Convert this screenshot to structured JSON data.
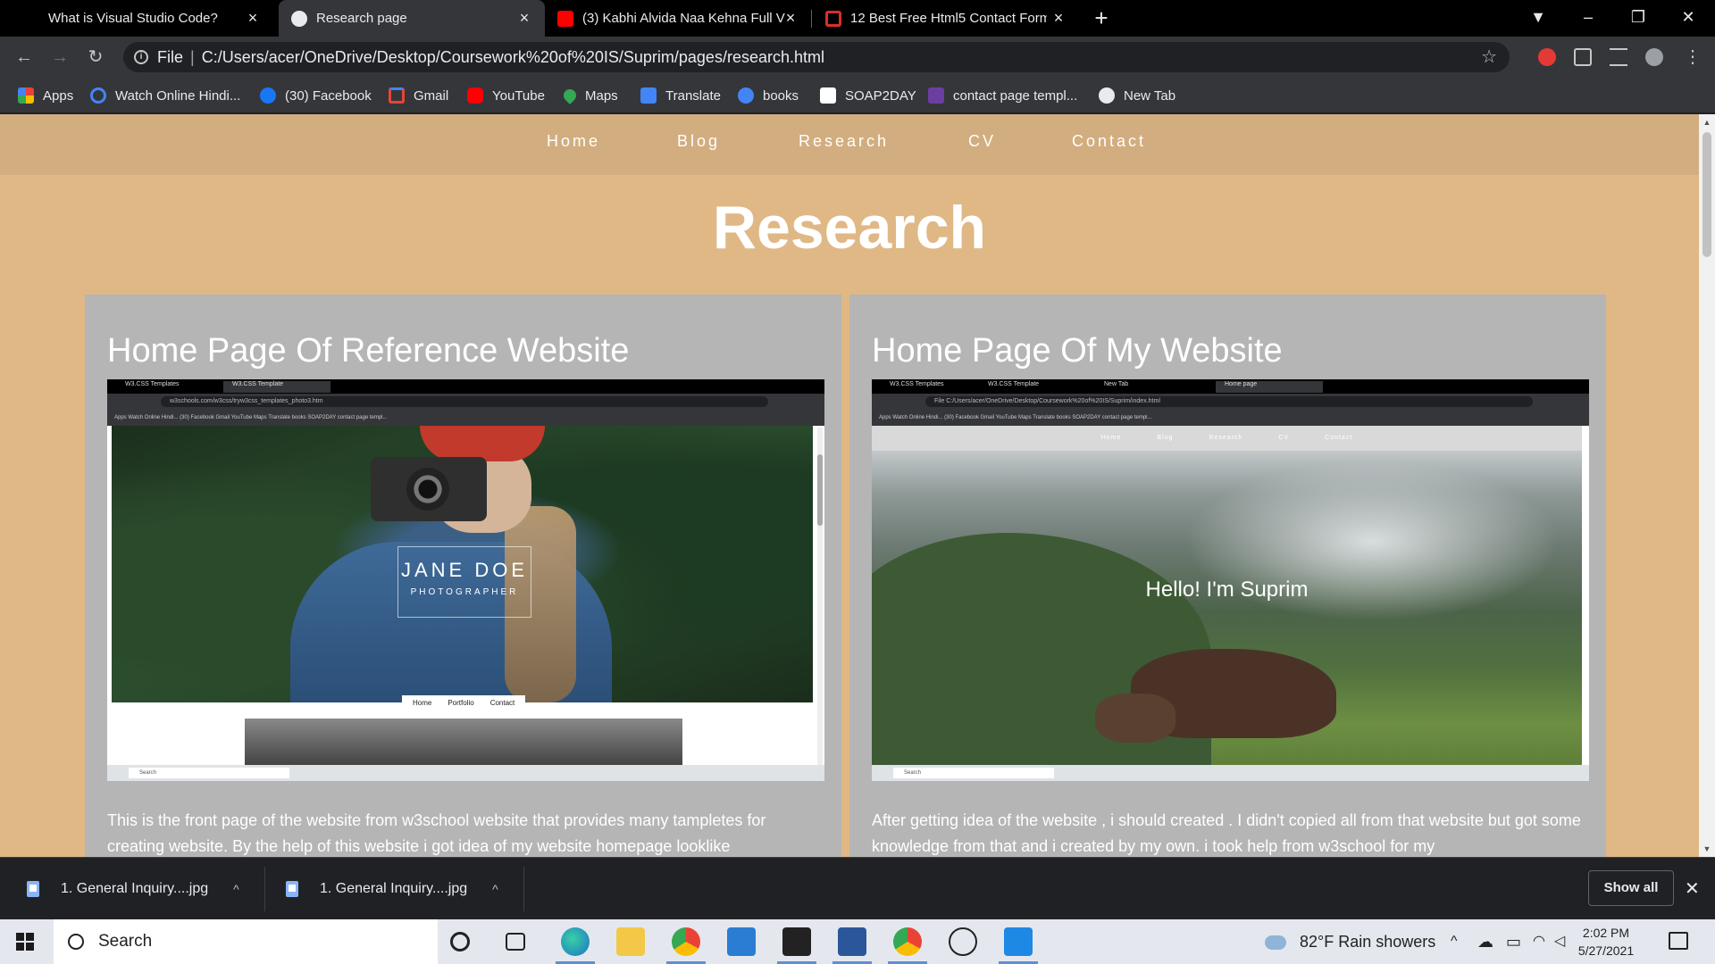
{
  "tabs": [
    {
      "title": "What is Visual Studio Code?",
      "active": false,
      "favicon_color": "#000000"
    },
    {
      "title": "Research page",
      "active": true,
      "favicon_color": "#e8eaed"
    },
    {
      "title": "(3) Kabhi Alvida Naa Kehna Full V",
      "active": false,
      "favicon_color": "#ff0000"
    },
    {
      "title": "12 Best Free Html5 Contact Form",
      "active": false,
      "favicon_color": "#d93025"
    }
  ],
  "tab_icons": {
    "close": "×",
    "new_tab": "+",
    "profile": "▼",
    "minimize": "–",
    "restore": "❐",
    "close_window": "✕"
  },
  "address": {
    "scheme": "File",
    "url": "C:/Users/acer/OneDrive/Desktop/Coursework%20of%20IS/Suprim/pages/research.html",
    "info_icon": "i",
    "star_icon": "☆"
  },
  "nav_icons": {
    "back": "←",
    "forward": "→",
    "reload": "↻",
    "menu": "⋮"
  },
  "bookmarks": [
    {
      "label": "Apps",
      "color": "#ea4335"
    },
    {
      "label": "Watch Online Hindi...",
      "color": "#4285f4"
    },
    {
      "label": "(30) Facebook",
      "color": "#1877f2"
    },
    {
      "label": "Gmail",
      "color": "#ea4335"
    },
    {
      "label": "YouTube",
      "color": "#ff0000"
    },
    {
      "label": "Maps",
      "color": "#34a853"
    },
    {
      "label": "Translate",
      "color": "#4285f4"
    },
    {
      "label": "books",
      "color": "#4285f4"
    },
    {
      "label": "SOAP2DAY",
      "color": "#ffffff"
    },
    {
      "label": "contact page templ...",
      "color": "#6b3fa0"
    },
    {
      "label": "New Tab",
      "color": "#e8eaed"
    }
  ],
  "site": {
    "nav": [
      "Home",
      "Blog",
      "Research",
      "CV",
      "Contact"
    ],
    "title": "Research",
    "cards": [
      {
        "heading": "Home Page Of Reference Website",
        "text": "This is the front page of the website from w3school website that provides many tampletes for creating website. By the help of this website i got idea of my website homepage looklike"
      },
      {
        "heading": "Home Page Of My Website",
        "text": "After getting idea of the website , i should created . I didn't copied all from that website but got some knowledge from that and i created by my own. i took help from w3school for my"
      }
    ],
    "left_shot": {
      "tabs": [
        "W3.CSS Templates",
        "W3.CSS Template"
      ],
      "url": "w3schools.com/w3css/tryw3css_templates_photo3.htm",
      "bookmarks": "Apps   Watch Online Hindi...   (30) Facebook   Gmail   YouTube   Maps   Translate   books   SOAP2DAY   contact page templ...",
      "brand_name": "JANE DOE",
      "brand_role": "PHOTOGRAPHER",
      "mini_nav": [
        "Home",
        "Portfolio",
        "Contact"
      ],
      "search": "Search"
    },
    "right_shot": {
      "tabs": [
        "W3.CSS Templates",
        "W3.CSS Template",
        "New Tab",
        "Home page"
      ],
      "url": "File   C:/Users/acer/OneDrive/Desktop/Coursework%20of%20IS/Suprim/index.html",
      "bookmarks": "Apps   Watch Online Hindi...   (30) Facebook   Gmail   YouTube   Maps   Translate   books   SOAP2DAY   contact page templ...",
      "nav": [
        "Home",
        "Blog",
        "Research",
        "CV",
        "Contact"
      ],
      "greeting": "Hello! I'm Suprim",
      "search": "Search"
    }
  },
  "downloads": {
    "items": [
      "1. General Inquiry....jpg",
      "1. General Inquiry....jpg"
    ],
    "caret": "^",
    "show_all": "Show all",
    "close": "✕"
  },
  "taskbar": {
    "search_placeholder": "Search",
    "weather": "82°F  Rain showers",
    "time": "2:02 PM",
    "date": "5/27/2021",
    "tray_icons": "^"
  }
}
